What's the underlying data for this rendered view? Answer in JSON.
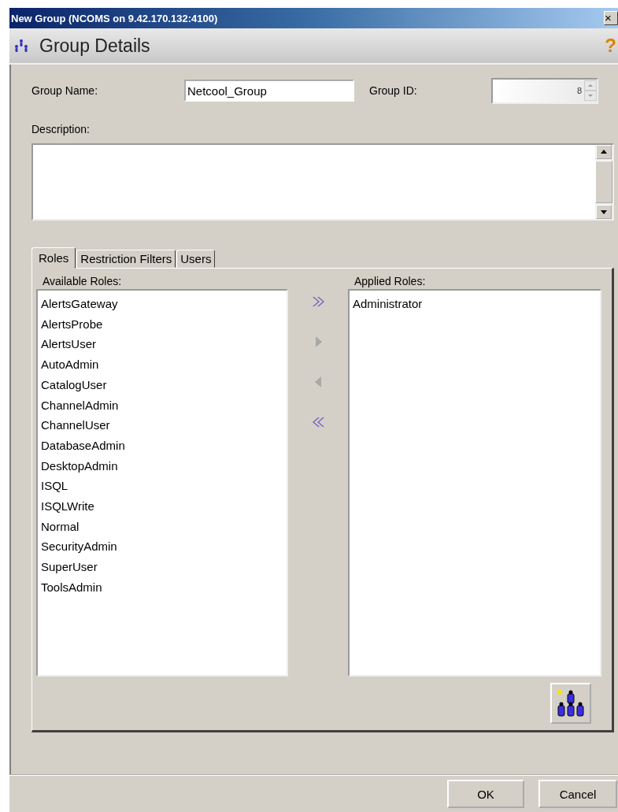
{
  "window": {
    "title": "New Group (NCOMS on 9.42.170.132:4100)",
    "close": "×"
  },
  "header": {
    "title": "Group Details",
    "help": "?"
  },
  "form": {
    "group_name": {
      "label": "Group Name:",
      "value": "Netcool_Group"
    },
    "group_id": {
      "label": "Group ID:",
      "value": "8"
    },
    "description": {
      "label": "Description:"
    }
  },
  "tabs": [
    {
      "label": "Roles",
      "selected": true
    },
    {
      "label": "Restriction Filters",
      "selected": false
    },
    {
      "label": "Users",
      "selected": false
    }
  ],
  "available_roles": {
    "label": "Available Roles:",
    "items": [
      "AlertsGateway",
      "AlertsProbe",
      "AlertsUser",
      "AutoAdmin",
      "CatalogUser",
      "ChannelAdmin",
      "ChannelUser",
      "DatabaseAdmin",
      "DesktopAdmin",
      "ISQL",
      "ISQLWrite",
      "Normal",
      "SecurityAdmin",
      "SuperUser",
      "ToolsAdmin"
    ]
  },
  "transfer_buttons": [
    {
      "kind": "add_all",
      "disabled": false
    },
    {
      "kind": "add",
      "disabled": true
    },
    {
      "kind": "remove",
      "disabled": true
    },
    {
      "kind": "remove_all",
      "disabled": false
    }
  ],
  "applied_roles": {
    "label": "Applied Roles:",
    "items": [
      "Administrator"
    ]
  },
  "buttons": [
    "OK",
    "Cancel"
  ]
}
